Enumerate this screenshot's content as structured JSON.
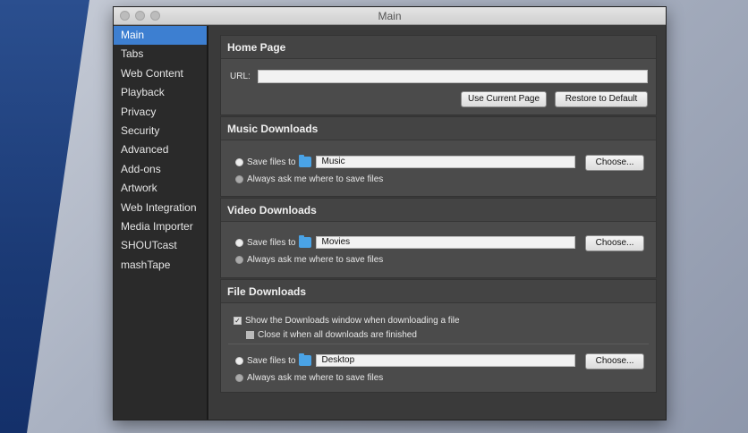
{
  "window": {
    "title": "Main"
  },
  "sidebar": {
    "items": [
      {
        "label": "Main"
      },
      {
        "label": "Tabs"
      },
      {
        "label": "Web Content"
      },
      {
        "label": "Playback"
      },
      {
        "label": "Privacy"
      },
      {
        "label": "Security"
      },
      {
        "label": "Advanced"
      },
      {
        "label": "Add-ons"
      },
      {
        "label": "Artwork"
      },
      {
        "label": "Web Integration"
      },
      {
        "label": "Media Importer"
      },
      {
        "label": "SHOUTcast"
      },
      {
        "label": "mashTape"
      }
    ],
    "selected": "Main"
  },
  "home_page": {
    "header": "Home Page",
    "url_label": "URL:",
    "url_value": "",
    "use_current_label": "Use Current Page",
    "restore_default_label": "Restore to Default"
  },
  "music_downloads": {
    "header": "Music Downloads",
    "save_files_label": "Save files to",
    "folder_name": "Music",
    "choose_label": "Choose...",
    "always_ask_label": "Always ask me where to save files"
  },
  "video_downloads": {
    "header": "Video Downloads",
    "save_files_label": "Save files to",
    "folder_name": "Movies",
    "choose_label": "Choose...",
    "always_ask_label": "Always ask me where to save files"
  },
  "file_downloads": {
    "header": "File Downloads",
    "show_window_label": "Show the Downloads window when downloading a file",
    "close_when_finished_label": "Close it when all downloads are finished",
    "save_files_label": "Save files to",
    "folder_name": "Desktop",
    "choose_label": "Choose...",
    "always_ask_label": "Always ask me where to save files"
  },
  "colors": {
    "selection": "#3d7fd1",
    "folder_icon": "#4aa3e6"
  }
}
